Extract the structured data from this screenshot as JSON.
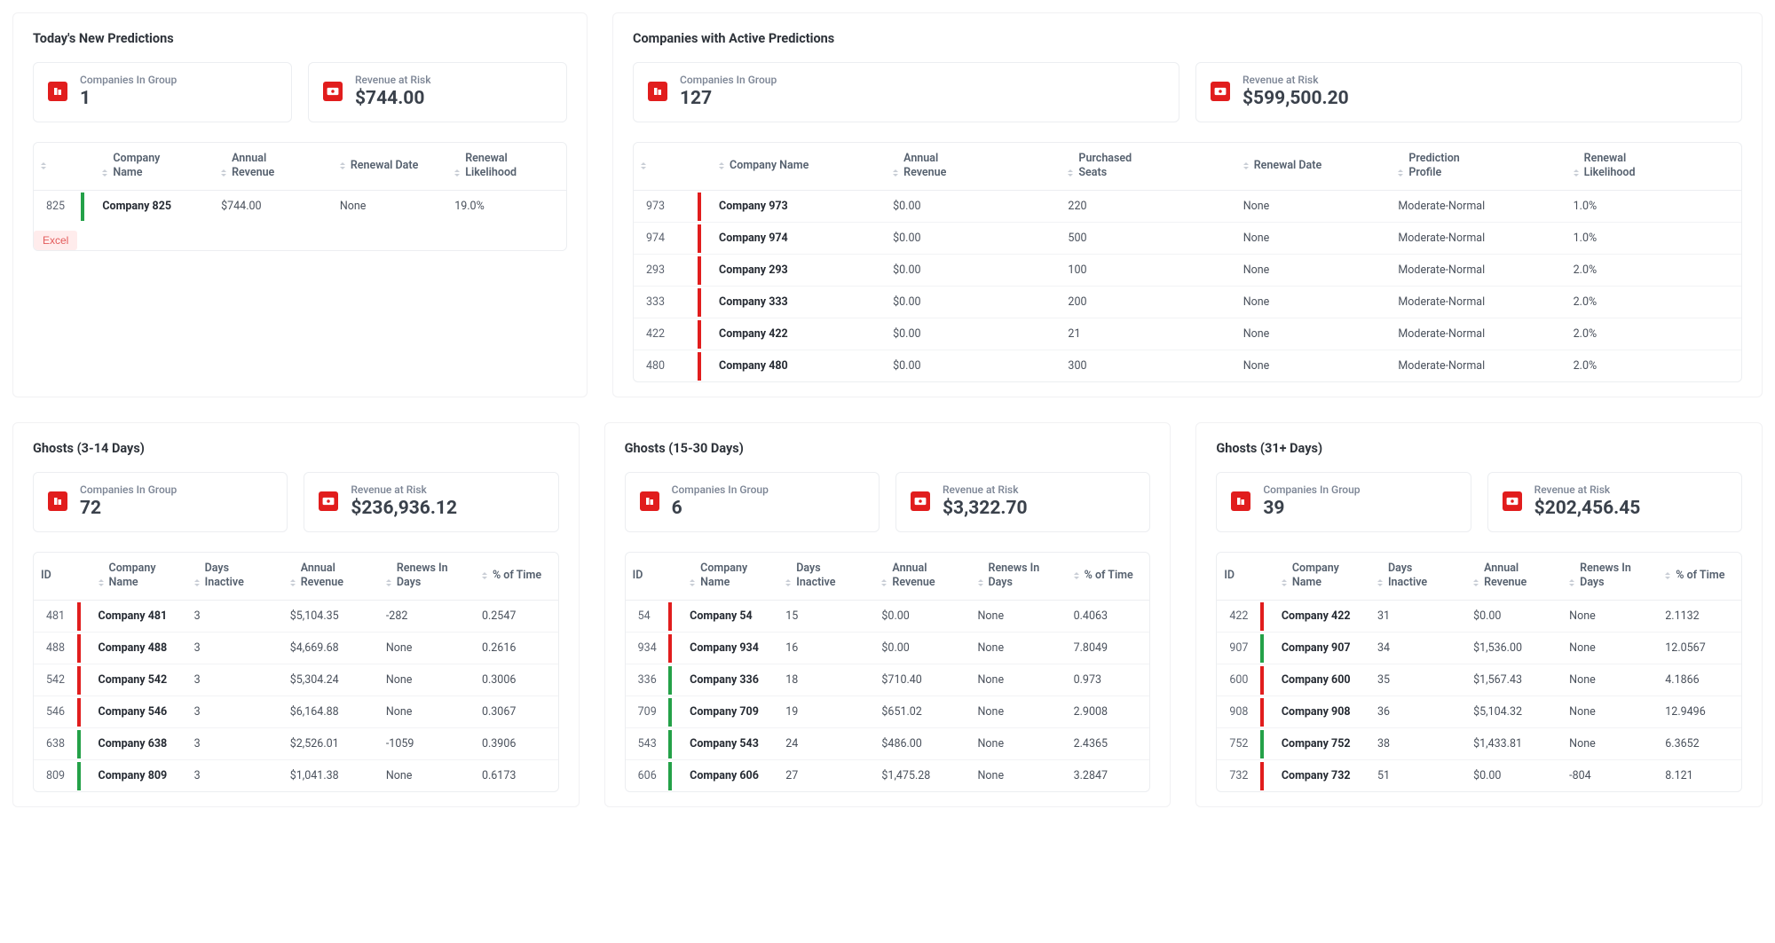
{
  "sections": {
    "today": {
      "title": "Today's New Predictions",
      "stats": {
        "companies_label": "Companies In Group",
        "companies_value": "1",
        "revenue_label": "Revenue at Risk",
        "revenue_value": "$744.00"
      },
      "headers": [
        "",
        "Company Name",
        "Annual Revenue",
        "Renewal Date",
        "Renewal Likelihood"
      ],
      "rows": [
        {
          "id": "825",
          "bar": "green",
          "company": "Company 825",
          "revenue": "$744.00",
          "renewal": "None",
          "likelihood": "19.0%"
        }
      ],
      "excel_label": "Excel"
    },
    "active": {
      "title": "Companies with Active Predictions",
      "stats": {
        "companies_label": "Companies In Group",
        "companies_value": "127",
        "revenue_label": "Revenue at Risk",
        "revenue_value": "$599,500.20"
      },
      "headers": [
        "",
        "Company Name",
        "Annual Revenue",
        "Purchased Seats",
        "Renewal Date",
        "Prediction Profile",
        "Renewal Likelihood"
      ],
      "rows": [
        {
          "id": "973",
          "bar": "red",
          "company": "Company 973",
          "revenue": "$0.00",
          "seats": "220",
          "renewal": "None",
          "profile": "Moderate-Normal",
          "likelihood": "1.0%"
        },
        {
          "id": "974",
          "bar": "red",
          "company": "Company 974",
          "revenue": "$0.00",
          "seats": "500",
          "renewal": "None",
          "profile": "Moderate-Normal",
          "likelihood": "1.0%"
        },
        {
          "id": "293",
          "bar": "red",
          "company": "Company 293",
          "revenue": "$0.00",
          "seats": "100",
          "renewal": "None",
          "profile": "Moderate-Normal",
          "likelihood": "2.0%"
        },
        {
          "id": "333",
          "bar": "red",
          "company": "Company 333",
          "revenue": "$0.00",
          "seats": "200",
          "renewal": "None",
          "profile": "Moderate-Normal",
          "likelihood": "2.0%"
        },
        {
          "id": "422",
          "bar": "red",
          "company": "Company 422",
          "revenue": "$0.00",
          "seats": "21",
          "renewal": "None",
          "profile": "Moderate-Normal",
          "likelihood": "2.0%"
        },
        {
          "id": "480",
          "bar": "red",
          "company": "Company 480",
          "revenue": "$0.00",
          "seats": "300",
          "renewal": "None",
          "profile": "Moderate-Normal",
          "likelihood": "2.0%"
        }
      ]
    },
    "ghosts3_14": {
      "title": "Ghosts (3-14 Days)",
      "stats": {
        "companies_label": "Companies In Group",
        "companies_value": "72",
        "revenue_label": "Revenue at Risk",
        "revenue_value": "$236,936.12"
      },
      "headers": [
        "ID",
        "Company Name",
        "Days Inactive",
        "Annual Revenue",
        "Renews In Days",
        "% of Time"
      ],
      "rows": [
        {
          "id": "481",
          "bar": "red",
          "company": "Company 481",
          "days": "3",
          "revenue": "$5,104.35",
          "renews": "-282",
          "pct": "0.2547"
        },
        {
          "id": "488",
          "bar": "red",
          "company": "Company 488",
          "days": "3",
          "revenue": "$4,669.68",
          "renews": "None",
          "pct": "0.2616"
        },
        {
          "id": "542",
          "bar": "red",
          "company": "Company 542",
          "days": "3",
          "revenue": "$5,304.24",
          "renews": "None",
          "pct": "0.3006"
        },
        {
          "id": "546",
          "bar": "red",
          "company": "Company 546",
          "days": "3",
          "revenue": "$6,164.88",
          "renews": "None",
          "pct": "0.3067"
        },
        {
          "id": "638",
          "bar": "green",
          "company": "Company 638",
          "days": "3",
          "revenue": "$2,526.01",
          "renews": "-1059",
          "pct": "0.3906"
        },
        {
          "id": "809",
          "bar": "green",
          "company": "Company 809",
          "days": "3",
          "revenue": "$1,041.38",
          "renews": "None",
          "pct": "0.6173"
        }
      ]
    },
    "ghosts15_30": {
      "title": "Ghosts (15-30 Days)",
      "stats": {
        "companies_label": "Companies In Group",
        "companies_value": "6",
        "revenue_label": "Revenue at Risk",
        "revenue_value": "$3,322.70"
      },
      "headers": [
        "ID",
        "Company Name",
        "Days Inactive",
        "Annual Revenue",
        "Renews In Days",
        "% of Time"
      ],
      "rows": [
        {
          "id": "54",
          "bar": "red",
          "company": "Company 54",
          "days": "15",
          "revenue": "$0.00",
          "renews": "None",
          "pct": "0.4063"
        },
        {
          "id": "934",
          "bar": "red",
          "company": "Company 934",
          "days": "16",
          "revenue": "$0.00",
          "renews": "None",
          "pct": "7.8049"
        },
        {
          "id": "336",
          "bar": "green",
          "company": "Company 336",
          "days": "18",
          "revenue": "$710.40",
          "renews": "None",
          "pct": "0.973"
        },
        {
          "id": "709",
          "bar": "green",
          "company": "Company 709",
          "days": "19",
          "revenue": "$651.02",
          "renews": "None",
          "pct": "2.9008"
        },
        {
          "id": "543",
          "bar": "green",
          "company": "Company 543",
          "days": "24",
          "revenue": "$486.00",
          "renews": "None",
          "pct": "2.4365"
        },
        {
          "id": "606",
          "bar": "green",
          "company": "Company 606",
          "days": "27",
          "revenue": "$1,475.28",
          "renews": "None",
          "pct": "3.2847"
        }
      ]
    },
    "ghosts31": {
      "title": "Ghosts (31+ Days)",
      "stats": {
        "companies_label": "Companies In Group",
        "companies_value": "39",
        "revenue_label": "Revenue at Risk",
        "revenue_value": "$202,456.45"
      },
      "headers": [
        "ID",
        "Company Name",
        "Days Inactive",
        "Annual Revenue",
        "Renews In Days",
        "% of Time"
      ],
      "rows": [
        {
          "id": "422",
          "bar": "red",
          "company": "Company 422",
          "days": "31",
          "revenue": "$0.00",
          "renews": "None",
          "pct": "2.1132"
        },
        {
          "id": "907",
          "bar": "green",
          "company": "Company 907",
          "days": "34",
          "revenue": "$1,536.00",
          "renews": "None",
          "pct": "12.0567"
        },
        {
          "id": "600",
          "bar": "red",
          "company": "Company 600",
          "days": "35",
          "revenue": "$1,567.43",
          "renews": "None",
          "pct": "4.1866"
        },
        {
          "id": "908",
          "bar": "red",
          "company": "Company 908",
          "days": "36",
          "revenue": "$5,104.32",
          "renews": "None",
          "pct": "12.9496"
        },
        {
          "id": "752",
          "bar": "green",
          "company": "Company 752",
          "days": "38",
          "revenue": "$1,433.81",
          "renews": "None",
          "pct": "6.3652"
        },
        {
          "id": "732",
          "bar": "red",
          "company": "Company 732",
          "days": "51",
          "revenue": "$0.00",
          "renews": "-804",
          "pct": "8.121"
        }
      ]
    }
  }
}
